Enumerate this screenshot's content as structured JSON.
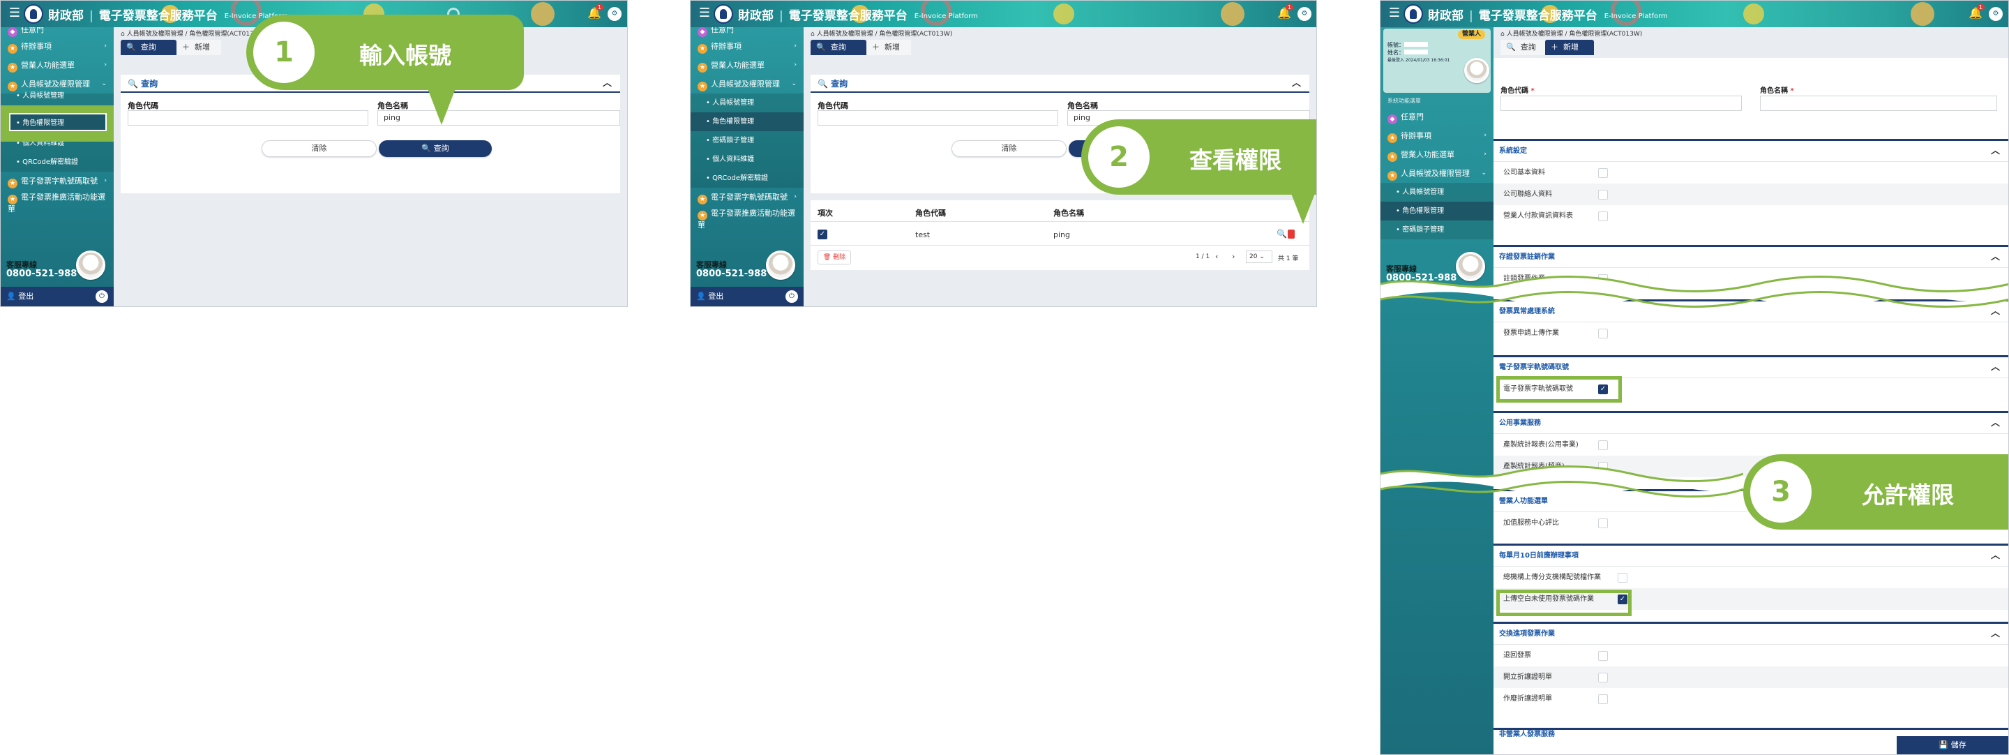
{
  "header": {
    "ministry": "財政部",
    "platform": "電子發票整合服務平台",
    "platform_en": "E-Invoice Platform",
    "notif_count": "1"
  },
  "sidebar": {
    "items": [
      "任意門",
      "待辦事項",
      "營業人功能選單",
      "人員帳號及權限管理"
    ],
    "sub_items": [
      "人員帳號管理",
      "角色權限管理",
      "密碼鎖子管理",
      "個人資料維護",
      "QRCode解密驗證"
    ],
    "more_items": [
      "電子發票字軌號碼取號",
      "電子發票推廣活動功能選單"
    ],
    "hotline_label": "客服專線",
    "hotline_number": "0800-521-988",
    "logout": "登出"
  },
  "page": {
    "breadcrumb_root": "人員帳號及權限管理",
    "breadcrumb_leaf1": "角色權限管理(ACT013)",
    "breadcrumb_leaf2": "角色權限管理(ACT013W)",
    "tab_query": "查詢",
    "tab_add": "新增",
    "card_title": "查詢",
    "field_code": "角色代碼",
    "field_name": "角色名稱",
    "name_value": "ping",
    "btn_clear": "清除",
    "btn_query": "查詢"
  },
  "results": {
    "headers": [
      "項次",
      "角色代碼",
      "角色名稱"
    ],
    "row": {
      "code": "test",
      "name": "ping"
    },
    "delete": "刪除",
    "pagination": "1 / 1",
    "per_page": "20",
    "total": "共 1 筆"
  },
  "callouts": [
    {
      "num": "1",
      "text": "輸入帳號"
    },
    {
      "num": "2",
      "text": "查看權限"
    },
    {
      "num": "3",
      "text": "允許權限"
    }
  ],
  "panel3": {
    "badge": "營業人",
    "acct_label": "帳號：",
    "name_label": "姓名：",
    "login_info": "最後登入 2024/01/03 16:36:01",
    "sys_menu": "系統功能選單",
    "required_code": "角色代碼",
    "required_name": "角色名稱",
    "required_mark": "*",
    "save": "儲存",
    "sections": [
      {
        "title": "系統設定",
        "items": [
          {
            "label": "公司基本資料",
            "checked": false
          },
          {
            "label": "公司聯絡人資料",
            "checked": false
          },
          {
            "label": "營業人付款資訊資料表",
            "checked": false
          }
        ]
      },
      {
        "title": "存證發票註銷作業",
        "items": [
          {
            "label": "註銷發票作業",
            "checked": false
          }
        ]
      },
      {
        "title": "發票異常處理系統",
        "items": [
          {
            "label": "發票申請上傳作業",
            "checked": false
          }
        ]
      },
      {
        "title": "電子發票字軌號碼取號",
        "items": [
          {
            "label": "電子發票字軌號碼取號",
            "checked": true
          }
        ]
      },
      {
        "title": "公用事業服務",
        "items": [
          {
            "label": "產製統計報表(公用事業)",
            "checked": false
          },
          {
            "label": "產製統計報表(超商)",
            "checked": false
          }
        ]
      },
      {
        "title": "營業人功能選單",
        "items": [
          {
            "label": "加值服務中心評比",
            "checked": false
          }
        ]
      },
      {
        "title": "每單月10日前應辦理事項",
        "items": [
          {
            "label": "總機構上傳分支機構配號檔作業",
            "checked": false
          },
          {
            "label": "上傳空白未使用發票號碼作業",
            "checked": true
          }
        ]
      },
      {
        "title": "交換進項發票作業",
        "items": [
          {
            "label": "退回發票",
            "checked": false
          },
          {
            "label": "開立折讓證明單",
            "checked": false
          },
          {
            "label": "作廢折讓證明單",
            "checked": false
          }
        ]
      },
      {
        "title": "非營業人發票服務",
        "items": []
      }
    ]
  }
}
